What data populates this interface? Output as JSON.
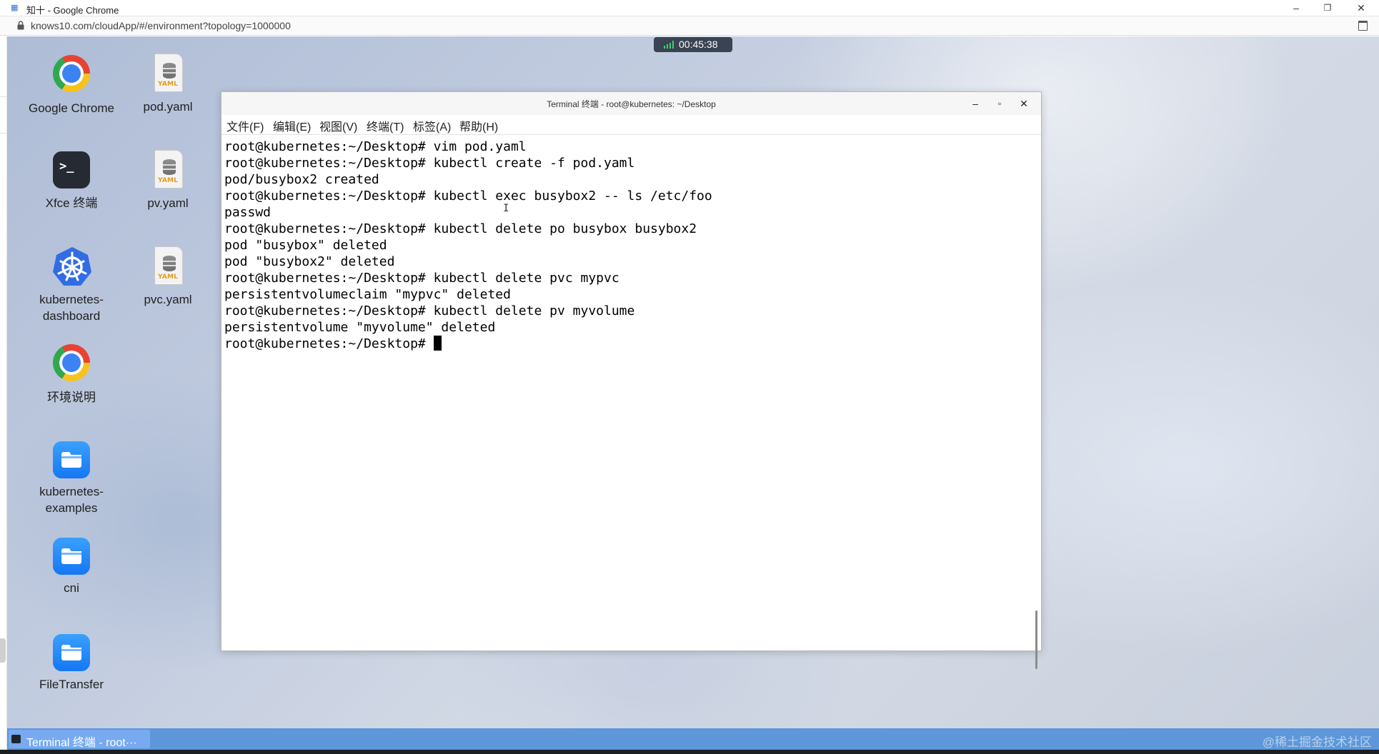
{
  "browser": {
    "tab_title": "知十 - Google Chrome",
    "favicon": "知十",
    "url": "knows10.com/cloudApp/#/environment?topology=1000000",
    "window_controls": [
      "–",
      "❐",
      "✕"
    ]
  },
  "session": {
    "timer": "00:45:38"
  },
  "desktop_icons": [
    {
      "label": "Google Chrome",
      "icon": "chrome-icon"
    },
    {
      "label": "pod.yaml",
      "icon": "yaml-file-icon"
    },
    {
      "label": "Xfce 终端",
      "icon": "terminal-icon"
    },
    {
      "label": "pv.yaml",
      "icon": "yaml-file-icon"
    },
    {
      "label": "kubernetes-dashboard",
      "icon": "kubernetes-icon"
    },
    {
      "label": "pvc.yaml",
      "icon": "yaml-file-icon"
    },
    {
      "label": "环境说明",
      "icon": "chrome-icon"
    },
    {
      "label": "kubernetes-examples",
      "icon": "folder-icon"
    },
    {
      "label": "cni",
      "icon": "folder-icon"
    },
    {
      "label": "FileTransfer",
      "icon": "folder-icon"
    }
  ],
  "icon_labels": {
    "chrome_line": "Google Chrome",
    "xfce": "Xfce 终端",
    "k8s_line1": "kubernetes-",
    "k8s_line2": "dashboard",
    "env": "环境说明",
    "examples_line1": "kubernetes-",
    "examples_line2": "examples",
    "yaml_tag": "YAML"
  },
  "terminal": {
    "title": "Terminal 终端 - root@kubernetes: ~/Desktop",
    "controls": [
      "–",
      "▫",
      "✕"
    ],
    "menu": [
      "文件(F)",
      "编辑(E)",
      "视图(V)",
      "终端(T)",
      "标签(A)",
      "帮助(H)"
    ],
    "lines": [
      "root@kubernetes:~/Desktop# vim pod.yaml",
      "root@kubernetes:~/Desktop# kubectl create -f pod.yaml",
      "pod/busybox2 created",
      "root@kubernetes:~/Desktop# kubectl exec busybox2 -- ls /etc/foo",
      "passwd",
      "root@kubernetes:~/Desktop# kubectl delete po busybox busybox2",
      "pod \"busybox\" deleted",
      "pod \"busybox2\" deleted",
      "root@kubernetes:~/Desktop# kubectl delete pvc mypvc",
      "persistentvolumeclaim \"mypvc\" deleted",
      "root@kubernetes:~/Desktop# kubectl delete pv myvolume",
      "persistentvolume \"myvolume\" deleted",
      "root@kubernetes:~/Desktop# "
    ]
  },
  "taskbar": {
    "task_label": "Terminal 终端 - root···",
    "watermark": "@稀土掘金技术社区"
  }
}
